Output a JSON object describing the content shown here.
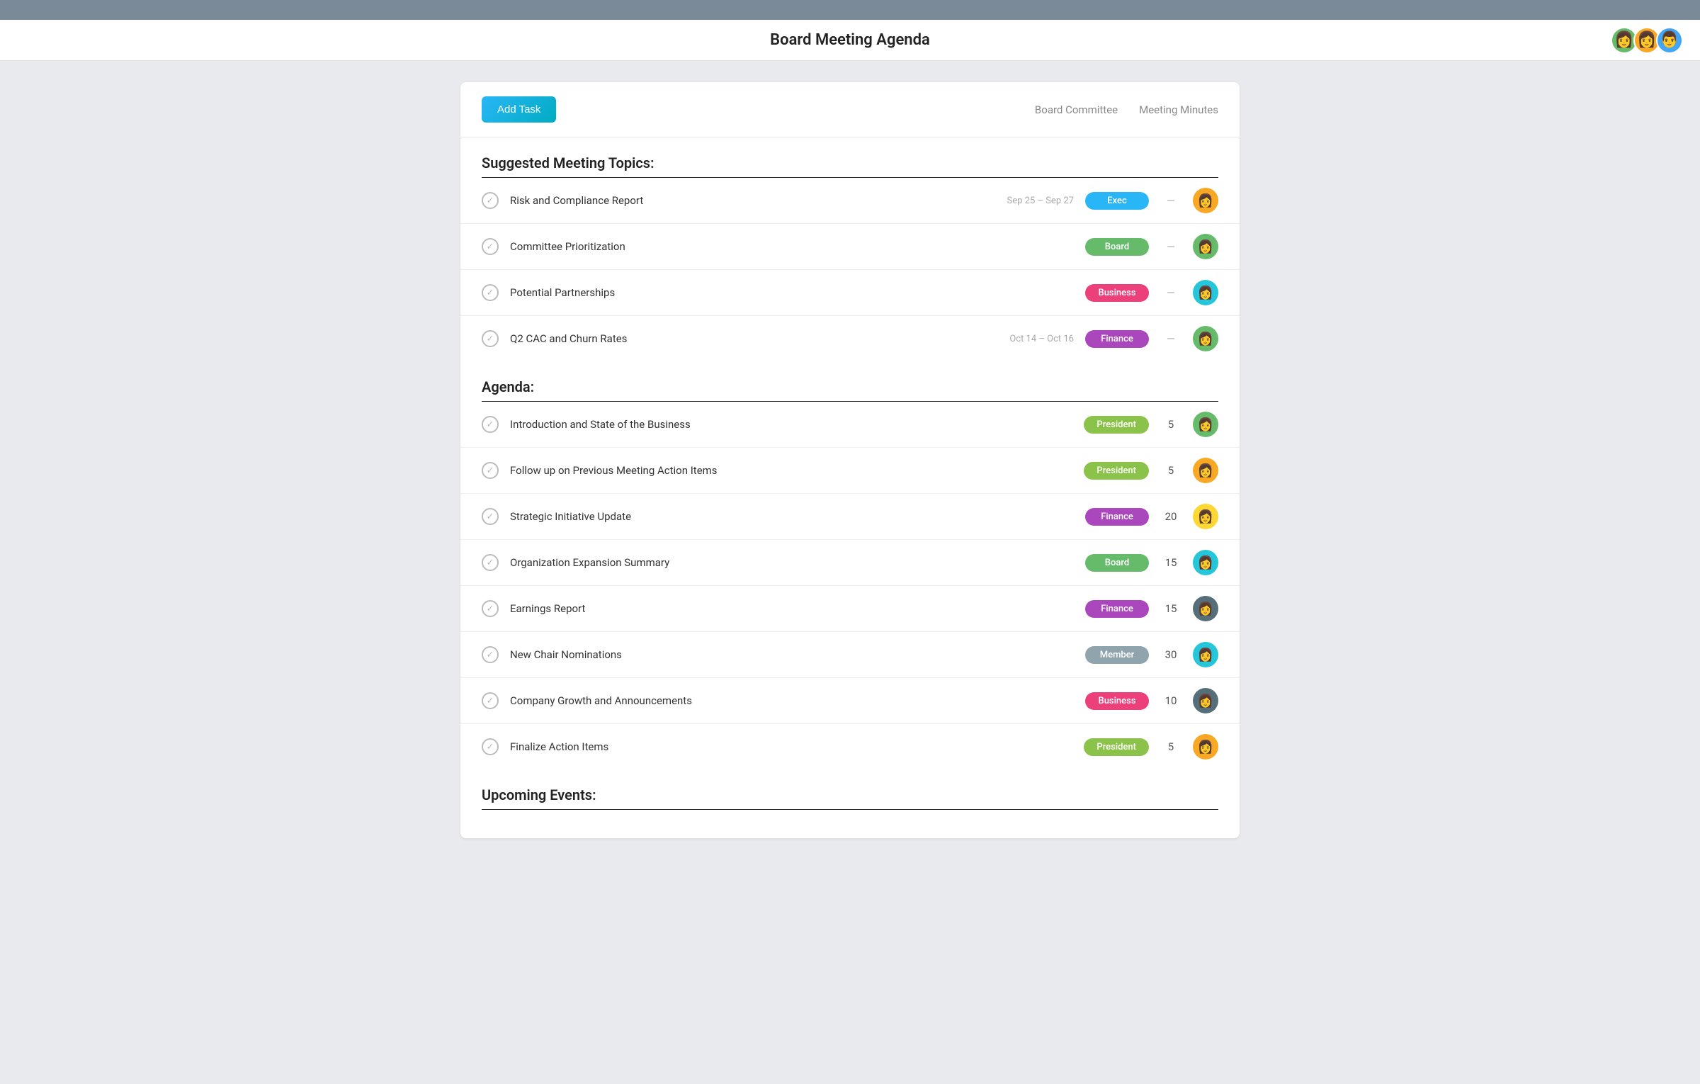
{
  "topbar": {},
  "header": {
    "title": "Board Meeting Agenda",
    "avatars": [
      {
        "id": "av1",
        "emoji": "👩",
        "color": "#66bb6a"
      },
      {
        "id": "av2",
        "emoji": "👩",
        "color": "#f9a825"
      },
      {
        "id": "av3",
        "emoji": "👨",
        "color": "#42a5f5"
      }
    ]
  },
  "toolbar": {
    "add_task_label": "Add Task",
    "links": [
      {
        "label": "Board Committee",
        "name": "board-committee-link"
      },
      {
        "label": "Meeting Minutes",
        "name": "meeting-minutes-link"
      }
    ]
  },
  "suggested_section": {
    "title": "Suggested Meeting Topics:",
    "items": [
      {
        "label": "Risk and Compliance Report",
        "date": "Sep 25 – Sep 27",
        "tag": "Exec",
        "tag_class": "tag-exec",
        "minutes": "—",
        "avatar_emoji": "👩",
        "avatar_color": "#f9a825"
      },
      {
        "label": "Committee Prioritization",
        "date": "",
        "tag": "Board",
        "tag_class": "tag-board",
        "minutes": "—",
        "avatar_emoji": "👩",
        "avatar_color": "#66bb6a"
      },
      {
        "label": "Potential Partnerships",
        "date": "",
        "tag": "Business",
        "tag_class": "tag-business",
        "minutes": "—",
        "avatar_emoji": "👩",
        "avatar_color": "#26c6da"
      },
      {
        "label": "Q2 CAC and Churn Rates",
        "date": "Oct 14 – Oct 16",
        "tag": "Finance",
        "tag_class": "tag-finance",
        "minutes": "—",
        "avatar_emoji": "👩",
        "avatar_color": "#66bb6a"
      }
    ]
  },
  "agenda_section": {
    "title": "Agenda:",
    "items": [
      {
        "label": "Introduction and State of the Business",
        "tag": "President",
        "tag_class": "tag-president",
        "minutes": "5",
        "avatar_emoji": "👩",
        "avatar_color": "#66bb6a"
      },
      {
        "label": "Follow up on Previous Meeting Action Items",
        "tag": "President",
        "tag_class": "tag-president",
        "minutes": "5",
        "avatar_emoji": "👩",
        "avatar_color": "#f9a825"
      },
      {
        "label": "Strategic Initiative Update",
        "tag": "Finance",
        "tag_class": "tag-finance",
        "minutes": "20",
        "avatar_emoji": "👩",
        "avatar_color": "#fdd835"
      },
      {
        "label": "Organization Expansion Summary",
        "tag": "Board",
        "tag_class": "tag-board",
        "minutes": "15",
        "avatar_emoji": "👩",
        "avatar_color": "#26c6da"
      },
      {
        "label": "Earnings Report",
        "tag": "Finance",
        "tag_class": "tag-finance",
        "minutes": "15",
        "avatar_emoji": "👩",
        "avatar_color": "#546e7a"
      },
      {
        "label": "New Chair Nominations",
        "tag": "Member",
        "tag_class": "tag-member",
        "minutes": "30",
        "avatar_emoji": "👩",
        "avatar_color": "#26c6da"
      },
      {
        "label": "Company Growth and Announcements",
        "tag": "Business",
        "tag_class": "tag-business",
        "minutes": "10",
        "avatar_emoji": "👩",
        "avatar_color": "#546e7a"
      },
      {
        "label": "Finalize Action Items",
        "tag": "President",
        "tag_class": "tag-president",
        "minutes": "5",
        "avatar_emoji": "👩",
        "avatar_color": "#f9a825"
      }
    ]
  },
  "upcoming_section": {
    "title": "Upcoming Events:"
  }
}
